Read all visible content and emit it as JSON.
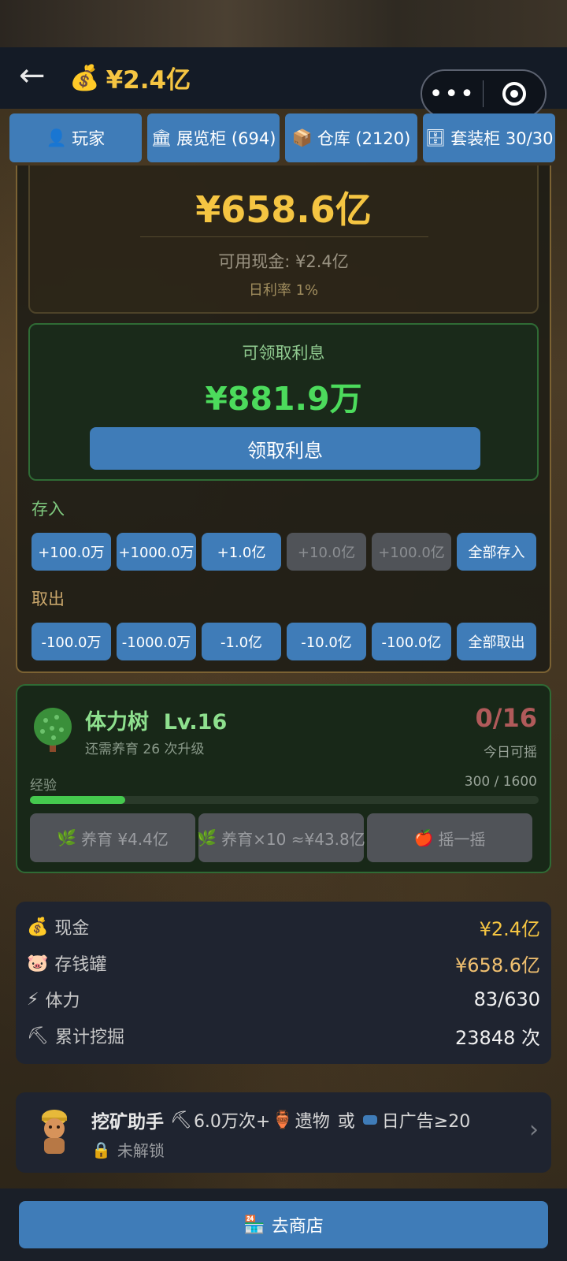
{
  "header": {
    "back_icon": "arrow-left-icon",
    "money_icon": "money-bag-icon",
    "cash": "¥2.4亿"
  },
  "capsule": {
    "menu": "•••",
    "close_icon": "target-circle-icon"
  },
  "tabs": [
    {
      "icon": "👤",
      "label": "玩家"
    },
    {
      "icon": "🏛",
      "label": "展览柜 (694)"
    },
    {
      "icon": "📦",
      "label": "仓库 (2120)"
    },
    {
      "icon": "🗄",
      "label": "套装柜 30/30"
    }
  ],
  "bank": {
    "balance": "¥658.6亿",
    "cash_line": "可用现金: ¥2.4亿",
    "rate_line": "日利率 1%",
    "interest_label": "可领取利息",
    "interest_value": "¥881.9万",
    "claim_label": "领取利息",
    "deposit_label": "存入",
    "deposit_buttons": [
      "+100.0万",
      "+1000.0万",
      "+1.0亿",
      "+10.0亿",
      "+100.0亿",
      "全部存入"
    ],
    "withdraw_label": "取出",
    "withdraw_buttons": [
      "-100.0万",
      "-1000.0万",
      "-1.0亿",
      "-10.0亿",
      "-100.0亿",
      "全部取出"
    ]
  },
  "tree": {
    "title": "体力树  Lv.16",
    "subtitle": "还需养育 26 次升级",
    "shake_count": "0/16",
    "shake_label": "今日可摇",
    "exp_label": "经验",
    "exp_value": "300 / 1600",
    "exp_fraction": 0.1875,
    "nurture_label": "养育 ¥4.4亿",
    "nurture10_label": "养育×10 ≈¥43.8亿",
    "shake_button": "摇一摇"
  },
  "stats": [
    {
      "icon": "💰",
      "label": "现金",
      "value": "¥2.4亿",
      "color": "#f5c542"
    },
    {
      "icon": "🐷",
      "label": "存钱罐",
      "value": "¥658.6亿",
      "color": "#f0c070"
    },
    {
      "icon": "⚡",
      "label": "体力",
      "value": "83/630",
      "color": "#f0f0f0"
    },
    {
      "icon": "⛏",
      "label": "累计挖掘",
      "value": "23848 次",
      "color": "#f0f0f0"
    }
  ],
  "helper": {
    "title": "挖矿助手",
    "req_a": "6.0万次+",
    "req_b": "遗物",
    "req_or": "或",
    "req_c": "日广告≥20",
    "status": "未解锁"
  },
  "footer": {
    "shop_icon": "🏪",
    "shop_label": "去商店"
  }
}
